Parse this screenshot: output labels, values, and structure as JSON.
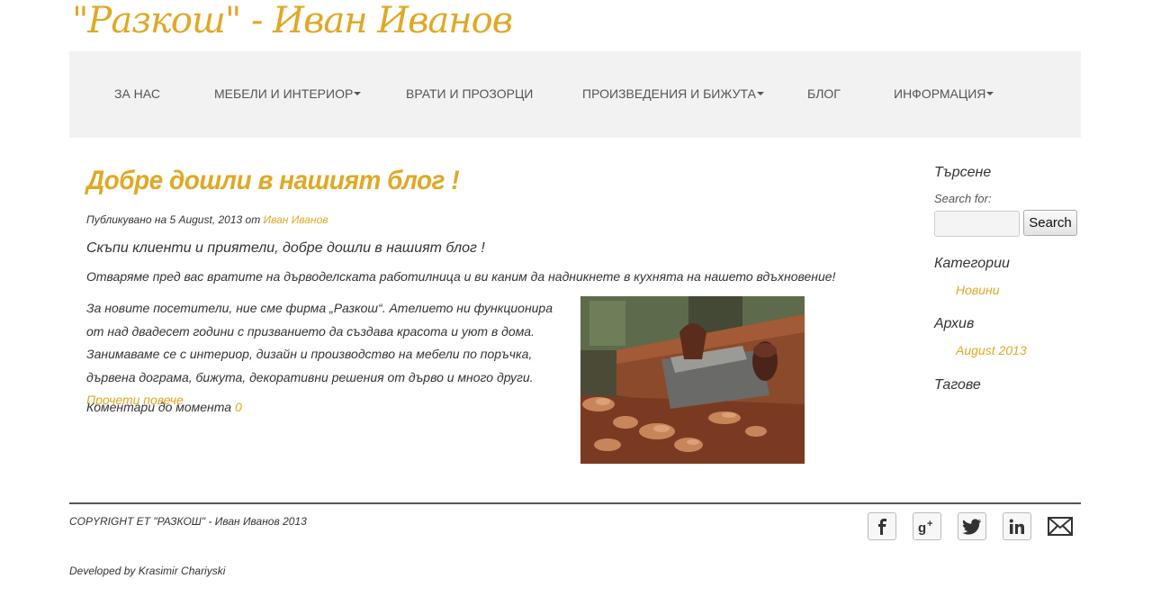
{
  "site": {
    "logo_text": "\"Разкош\" - Иван Иванов"
  },
  "nav": {
    "items": [
      {
        "label": "ЗА НАС",
        "dropdown": false
      },
      {
        "label": "МЕБЕЛИ И ИНТЕРИОР",
        "dropdown": true
      },
      {
        "label": "ВРАТИ И ПРОЗОРЦИ",
        "dropdown": false
      },
      {
        "label": "ПРОИЗВЕДЕНИЯ И БИЖУТА",
        "dropdown": true
      },
      {
        "label": "БЛОГ",
        "dropdown": false
      },
      {
        "label": "ИНФОРМАЦИЯ",
        "dropdown": true
      }
    ]
  },
  "post": {
    "title": "Добре дошли в нашият блог !",
    "meta_prefix": "Публикувано на 5 August, 2013 от ",
    "author": "Иван Иванов",
    "lead": "Скъпи клиенти и приятели, добре дошли в нашият блог !",
    "paragraph2": "Отваряме пред вас вратите на дърводелската работилница и ви каним да надникнете в кухнята на нашето вдъхновение!",
    "paragraph3": "За новите посетители, ние сме фирма „Разкош“. Ателието ни функционира от над двадесет години с призванието да създава красота и уют в дома. Занимаваме се с интериор, дизайн и производство на мебели по поръчка, дървена дограма, бижута, декоративни решения от дърво и много други.",
    "read_more": "Прочети повече",
    "comments_label": "Коментари до момента",
    "comments_count": "0",
    "image_icon": "woodworking-plane-photo"
  },
  "sidebar": {
    "search_title": "Търсене",
    "search_label": "Search for:",
    "search_button": "Search",
    "categories_title": "Категории",
    "categories": [
      "Новини"
    ],
    "archive_title": "Архив",
    "archive": [
      "August 2013"
    ],
    "tags_title": "Тагове"
  },
  "footer": {
    "copyright": "COPYRIGHT ЕТ \"РАЗКОШ\" - Иван Иванов 2013",
    "developed": "Developed by Krasimir Chariyski",
    "social_icons": [
      "facebook-icon",
      "google-plus-icon",
      "twitter-icon",
      "linkedin-icon",
      "mail-icon"
    ]
  },
  "colors": {
    "accent": "#e0a825",
    "nav_bg": "#f2f2f2",
    "text": "#333333"
  }
}
